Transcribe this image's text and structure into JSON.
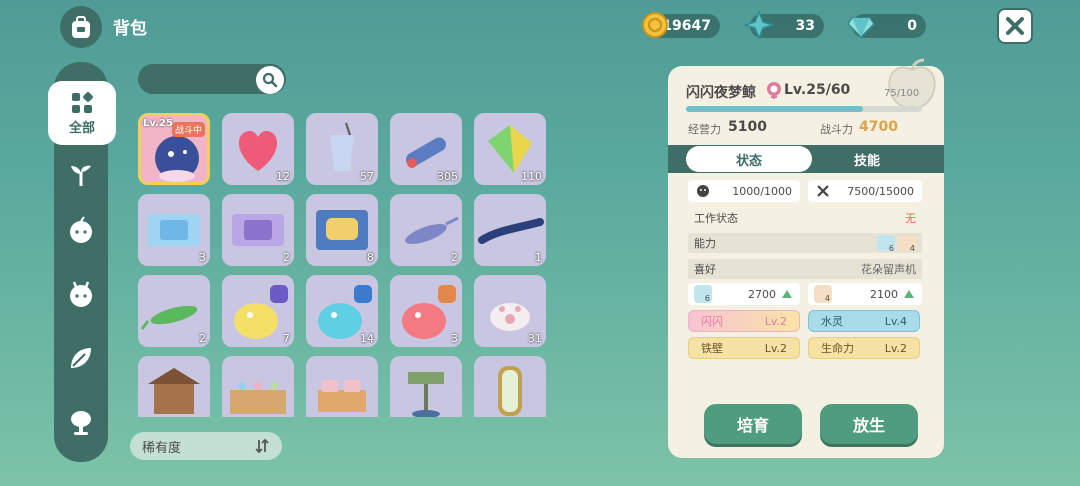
{
  "header": {
    "title": "背包",
    "coins": "19647",
    "stars": "33",
    "gems": "0"
  },
  "nav": {
    "all_label": "全部"
  },
  "sort": {
    "label": "稀有度"
  },
  "items": [
    {
      "name": "sparkle-whale",
      "count": "",
      "level": "Lv.25",
      "badge": "战斗中"
    },
    {
      "name": "heart",
      "count": "12"
    },
    {
      "name": "drink-cup",
      "count": "57"
    },
    {
      "name": "spray-bottle",
      "count": "305"
    },
    {
      "name": "green-crystal",
      "count": "110"
    },
    {
      "name": "blue-ticket",
      "count": "3"
    },
    {
      "name": "purple-ticket",
      "count": "2"
    },
    {
      "name": "sofa-card",
      "count": "8"
    },
    {
      "name": "swordfish",
      "count": "2"
    },
    {
      "name": "eel",
      "count": "1"
    },
    {
      "name": "green-fish",
      "count": "2"
    },
    {
      "name": "yellow-slime",
      "count": "7"
    },
    {
      "name": "blue-slime",
      "count": "14"
    },
    {
      "name": "pink-slime",
      "count": "3"
    },
    {
      "name": "paw-cushion",
      "count": "31"
    },
    {
      "name": "wood-house",
      "count": ""
    },
    {
      "name": "shelf",
      "count": ""
    },
    {
      "name": "box",
      "count": ""
    },
    {
      "name": "signpost",
      "count": ""
    },
    {
      "name": "mirror",
      "count": ""
    }
  ],
  "pet": {
    "name": "闪闪夜梦鲸",
    "gender_icon": "female-icon",
    "level": "Lv.25/60",
    "exp": "75/100",
    "exp_fraction": 0.75,
    "manage_label": "经营力",
    "manage_value": "5100",
    "combat_label": "战斗力",
    "combat_value": "4700",
    "tab_state": "状态",
    "tab_skill": "技能",
    "hunger": "1000/1000",
    "stamina": "7500/15000",
    "work_label": "工作状态",
    "work_value": "无",
    "ability_label": "能力",
    "ability_vals": [
      "6",
      "4"
    ],
    "hobby_label": "喜好",
    "hobby_value": "花朵留声机",
    "stat1": "2700",
    "stat1_icon": "6",
    "stat2": "2100",
    "stat2_icon": "4",
    "traits": [
      {
        "name": "闪闪",
        "level": "Lv.2"
      },
      {
        "name": "水灵",
        "level": "Lv.4"
      },
      {
        "name": "铁壁",
        "level": "Lv.2"
      },
      {
        "name": "生命力",
        "level": "Lv.2"
      }
    ],
    "breed_label": "培育",
    "release_label": "放生"
  },
  "colors": {
    "accent": "#3f6e66",
    "combat": "#e0a14a",
    "button": "#4f9c7e"
  }
}
